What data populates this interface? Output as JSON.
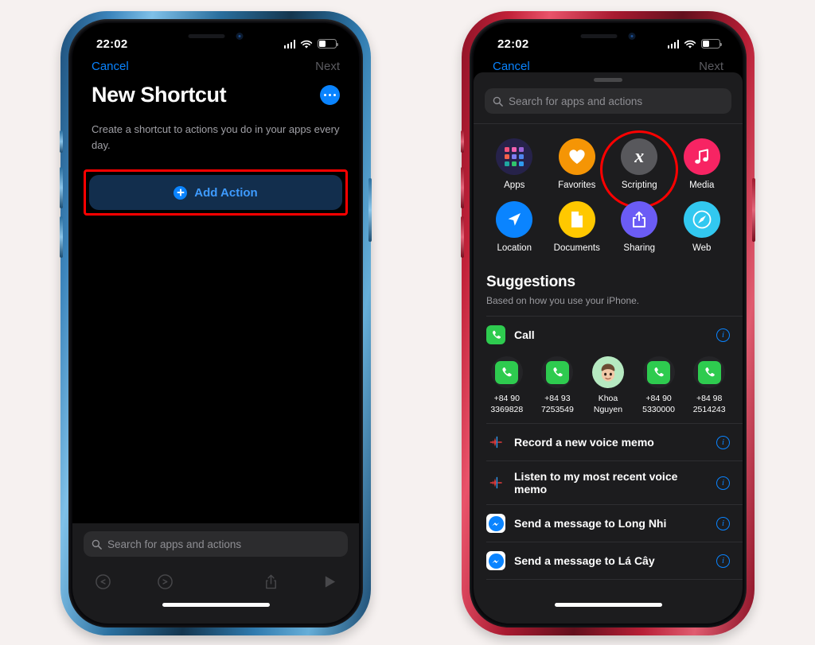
{
  "background_color": "#f6f1f0",
  "left_phone": {
    "frame_color": "#3d86bd",
    "status": {
      "time": "22:02",
      "signal_icon": "cellular-bars-icon",
      "wifi_icon": "wifi-icon",
      "battery_icon": "battery-icon"
    },
    "nav": {
      "cancel": "Cancel",
      "next": "Next"
    },
    "title": "New Shortcut",
    "more_button": "more-options-icon",
    "subtitle": "Create a shortcut to actions you do in your apps every day.",
    "add_action": {
      "label": "Add Action",
      "icon": "plus-circle-icon",
      "highlight_color": "#ff0000"
    },
    "search": {
      "placeholder": "Search for apps and actions",
      "icon": "search-icon"
    },
    "toolbar": {
      "undo": "undo-icon",
      "redo": "redo-icon",
      "share": "share-icon",
      "play": "play-icon"
    }
  },
  "right_phone": {
    "frame_color": "#c22239",
    "status": {
      "time": "22:02",
      "signal_icon": "cellular-bars-icon",
      "wifi_icon": "wifi-icon",
      "battery_icon": "battery-icon"
    },
    "nav": {
      "cancel": "Cancel",
      "next": "Next"
    },
    "sheet": {
      "search": {
        "placeholder": "Search for apps and actions",
        "icon": "search-icon"
      },
      "categories": [
        {
          "label": "Apps",
          "icon": "apps-grid-icon",
          "color": "#26224a",
          "highlighted": false
        },
        {
          "label": "Favorites",
          "icon": "heart-icon",
          "color": "#f59505",
          "highlighted": false
        },
        {
          "label": "Scripting",
          "icon": "scripting-x-icon",
          "color": "#58585c",
          "highlighted": true
        },
        {
          "label": "Media",
          "icon": "music-note-icon",
          "color": "#f72463",
          "highlighted": false
        },
        {
          "label": "Location",
          "icon": "navigation-arrow-icon",
          "color": "#0a84ff",
          "highlighted": false
        },
        {
          "label": "Documents",
          "icon": "document-icon",
          "color": "#ffc800",
          "highlighted": false
        },
        {
          "label": "Sharing",
          "icon": "share-icon",
          "color": "#6b5cf5",
          "highlighted": false
        },
        {
          "label": "Web",
          "icon": "compass-icon",
          "color": "#32c8f0",
          "highlighted": false
        }
      ],
      "suggestions": {
        "title": "Suggestions",
        "subtitle": "Based on how you use your iPhone.",
        "call_row": {
          "label": "Call",
          "icon": "phone-icon",
          "info": "info-icon"
        },
        "contacts": [
          {
            "name": "+84 90 3369828",
            "line1": "+84 90",
            "line2": "3369828",
            "avatar": "phone-icon"
          },
          {
            "name": "+84 93 7253549",
            "line1": "+84 93",
            "line2": "7253549",
            "avatar": "phone-icon"
          },
          {
            "name": "Khoa Nguyen",
            "line1": "Khoa",
            "line2": "Nguyen",
            "avatar": "memoji-avatar"
          },
          {
            "name": "+84 90 5330000",
            "line1": "+84 90",
            "line2": "5330000",
            "avatar": "phone-icon"
          },
          {
            "name": "+84 98 2514243",
            "line1": "+84 98",
            "line2": "2514243",
            "avatar": "phone-icon"
          }
        ],
        "items": [
          {
            "label": "Record a new voice memo",
            "icon": "voice-memo-icon",
            "info": "info-icon"
          },
          {
            "label": "Listen to my most recent voice memo",
            "icon": "voice-memo-icon",
            "info": "info-icon"
          },
          {
            "label": "Send a message to Long Nhi",
            "icon": "messenger-icon",
            "info": "info-icon"
          },
          {
            "label": "Send a message to Lá Cây",
            "icon": "messenger-icon",
            "info": "info-icon"
          }
        ]
      }
    }
  }
}
